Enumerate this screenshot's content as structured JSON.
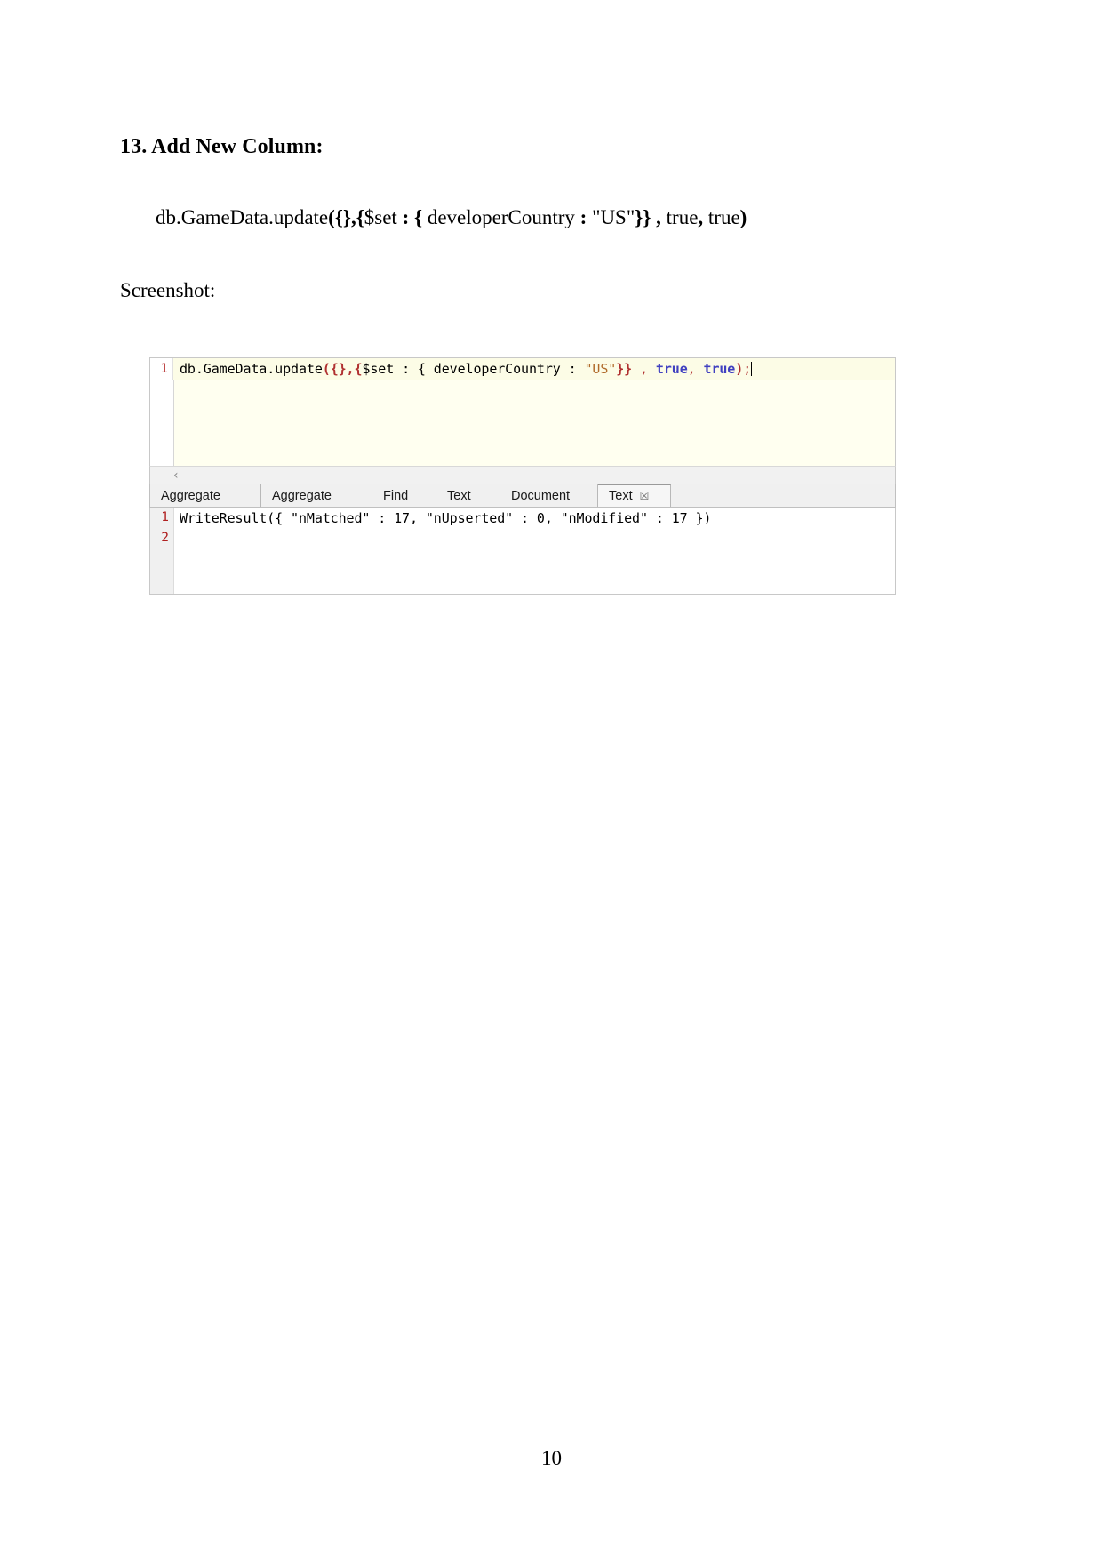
{
  "document": {
    "heading": "13. Add New Column:",
    "command_segments": [
      {
        "text": "db.GameData.update",
        "bold": false
      },
      {
        "text": "({},{",
        "bold": true
      },
      {
        "text": "$set ",
        "bold": false
      },
      {
        "text": ": {",
        "bold": true
      },
      {
        "text": " developerCountry ",
        "bold": false
      },
      {
        "text": ":",
        "bold": true
      },
      {
        "text": " \"US\"",
        "bold": false
      },
      {
        "text": "}} ,",
        "bold": true
      },
      {
        "text": " true",
        "bold": false
      },
      {
        "text": ",",
        "bold": true
      },
      {
        "text": " true",
        "bold": false
      },
      {
        "text": ")",
        "bold": true
      }
    ],
    "command_plain": "db.GameData.update({},{$set : { developerCountry : \"US\"}} , true, true)",
    "screenshot_label": "Screenshot:",
    "page_number": "10"
  },
  "ide": {
    "editor": {
      "line_number": "1",
      "tokens": [
        {
          "text": "db.GameData.update",
          "type": "plain"
        },
        {
          "text": "({},{",
          "type": "paren"
        },
        {
          "text": "$set : { developerCountry : ",
          "type": "plain"
        },
        {
          "text": "\"US\"",
          "type": "str"
        },
        {
          "text": "}}",
          "type": "paren"
        },
        {
          "text": " ",
          "type": "plain"
        },
        {
          "text": ",",
          "type": "punc"
        },
        {
          "text": " ",
          "type": "plain"
        },
        {
          "text": "true",
          "type": "kw"
        },
        {
          "text": ",",
          "type": "punc"
        },
        {
          "text": " ",
          "type": "plain"
        },
        {
          "text": "true",
          "type": "kw"
        },
        {
          "text": ")",
          "type": "paren"
        },
        {
          "text": ";",
          "type": "punc"
        }
      ],
      "full_text": "db.GameData.update({},{$set : { developerCountry : \"US\"}} , true, true);"
    },
    "scrollbar": {
      "chevron_glyph": "‹"
    },
    "tabs": [
      {
        "label": "Aggregate",
        "active": false,
        "closable": false
      },
      {
        "label": "Aggregate",
        "active": false,
        "closable": false
      },
      {
        "label": "Find",
        "active": false,
        "closable": false
      },
      {
        "label": "Text",
        "active": false,
        "closable": false
      },
      {
        "label": "Document",
        "active": false,
        "closable": false
      },
      {
        "label": "Text",
        "active": true,
        "closable": true,
        "close_glyph": "☒"
      }
    ],
    "results": {
      "lines": [
        {
          "number": "1",
          "text": "WriteResult({ \"nMatched\" : 17, \"nUpserted\" : 0, \"nModified\" : 17 })"
        },
        {
          "number": "2",
          "text": ""
        }
      ]
    }
  },
  "colors": {
    "editor_bg": "#fcfce6",
    "paren_red": "#b03030",
    "string_orange": "#b06a2a",
    "keyword_blue": "#4040c0",
    "lineno_red": "#b02020",
    "tab_bg": "#f0f0f0"
  }
}
